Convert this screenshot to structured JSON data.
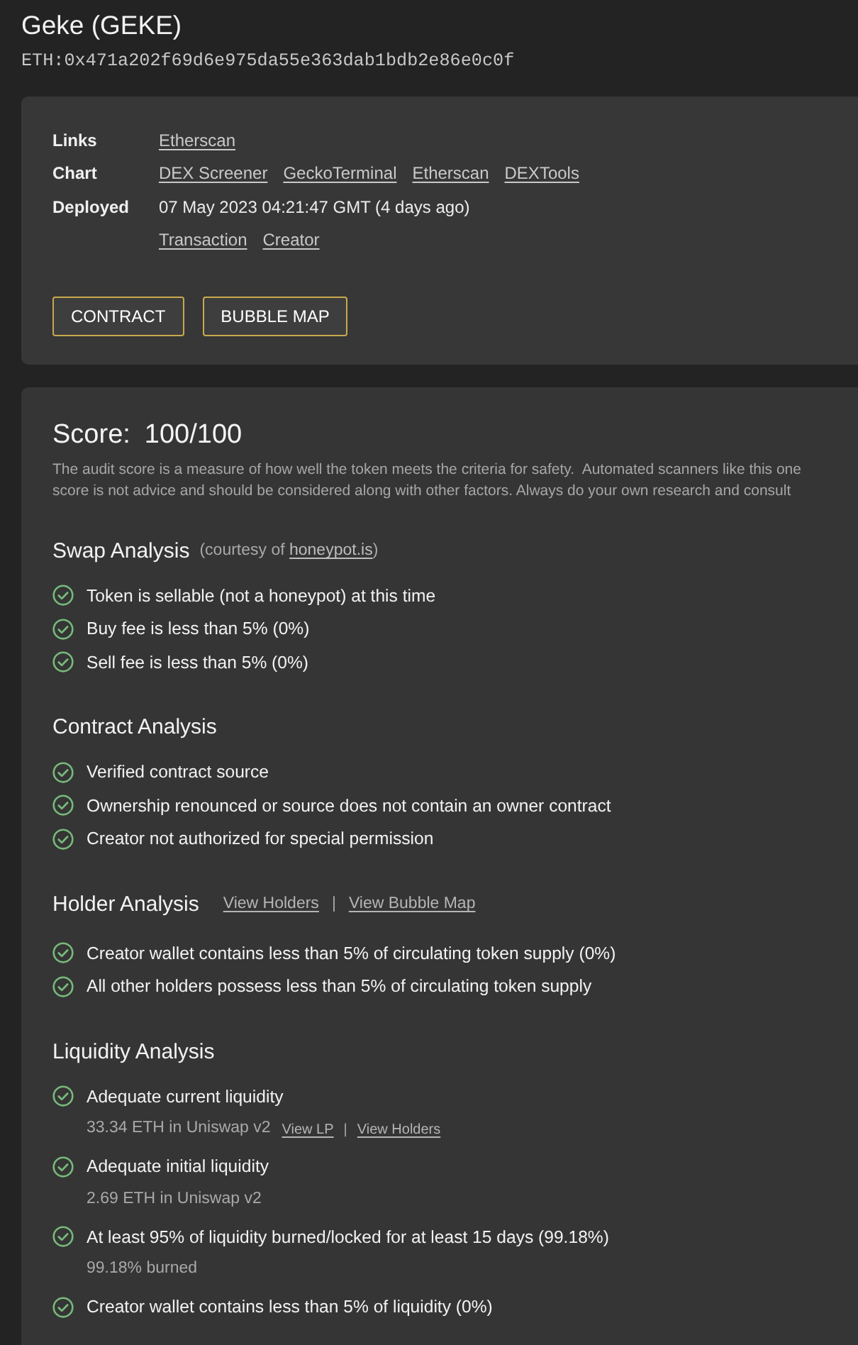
{
  "token": {
    "name": "Geke (GEKE)",
    "address": "ETH:0x471a202f69d6e975da55e363dab1bdb2e86e0c0f"
  },
  "info": {
    "rows": [
      {
        "label": "Links",
        "links": [
          "Etherscan"
        ]
      },
      {
        "label": "Chart",
        "links": [
          "DEX Screener",
          "GeckoTerminal",
          "Etherscan",
          "DEXTools"
        ]
      },
      {
        "label": "Deployed",
        "value": "07 May 2023 04:21:47 GMT (4 days ago)"
      },
      {
        "links": [
          "Transaction",
          "Creator"
        ]
      }
    ],
    "buttons": [
      "CONTRACT",
      "BUBBLE MAP"
    ]
  },
  "audit": {
    "score_label": "Score:",
    "score": "100/100",
    "description_lines": [
      "The audit score is a measure of how well the token meets the criteria for safety.  Automated scanners like this one",
      "score is not advice and should be considered along with other factors. Always do your own research and consult"
    ],
    "sections": [
      {
        "title": "Swap Analysis",
        "note": {
          "text": "(courtesy of ",
          "link": "honeypot.is",
          "end": ")"
        },
        "items": [
          {
            "text": "Token is sellable (not a honeypot) at this time",
            "passed": true
          },
          {
            "text": "Buy fee is less than 5% (0%)",
            "passed": true
          },
          {
            "text": "Sell fee is less than 5% (0%)",
            "passed": true
          }
        ]
      },
      {
        "title": "Contract Analysis",
        "items": [
          {
            "text": "Verified contract source",
            "passed": true
          },
          {
            "text": "Ownership renounced or source does not contain an owner contract",
            "passed": true
          },
          {
            "text": "Creator not authorized for special permission",
            "passed": true
          }
        ]
      },
      {
        "title": "Holder Analysis",
        "links": [
          "View Holders",
          "View Bubble Map"
        ],
        "separator": "|",
        "items": [
          {
            "text": "Creator wallet contains less than 5% of circulating token supply (0%)",
            "passed": true
          },
          {
            "text": "All other holders possess less than 5% of circulating token supply",
            "passed": true
          }
        ]
      },
      {
        "title": "Liquidity Analysis",
        "items": [
          {
            "text": "Adequate current liquidity",
            "passed": true,
            "detail": {
              "text": "33.34 ETH in Uniswap v2",
              "links": [
                "View LP",
                "View Holders"
              ],
              "separator": "|"
            }
          },
          {
            "text": "Adequate initial liquidity",
            "passed": true,
            "detail": {
              "text": "2.69 ETH in Uniswap v2"
            }
          },
          {
            "text": "At least 95% of liquidity burned/locked for at least 15 days (99.18%)",
            "passed": true,
            "detail": {
              "text": "99.18% burned"
            }
          },
          {
            "text": "Creator wallet contains less than 5% of liquidity (0%)",
            "passed": true
          }
        ]
      }
    ]
  }
}
